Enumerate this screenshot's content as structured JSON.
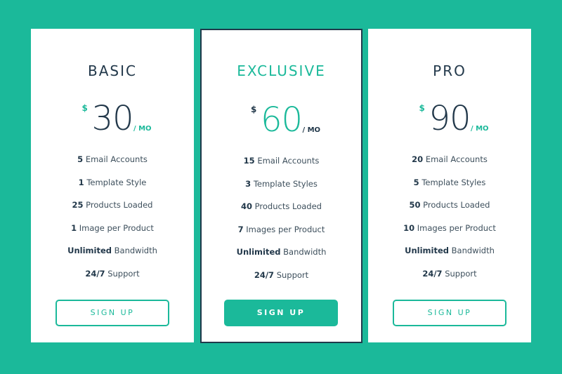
{
  "colors": {
    "background": "#1bb99a",
    "accent": "#1bb99a",
    "dark": "#22384a",
    "card": "#ffffff"
  },
  "plans": [
    {
      "name": "BASIC",
      "currency": "$",
      "price": "30",
      "period": "/ MO",
      "features": [
        {
          "bold": "5",
          "text": " Email Accounts"
        },
        {
          "bold": "1",
          "text": " Template Style"
        },
        {
          "bold": "25",
          "text": " Products Loaded"
        },
        {
          "bold": "1",
          "text": " Image per Product"
        },
        {
          "bold": "Unlimited",
          "text": " Bandwidth"
        },
        {
          "bold": "24/7",
          "text": " Support"
        }
      ],
      "button": "SIGN UP"
    },
    {
      "name": "EXCLUSIVE",
      "currency": "$",
      "price": "60",
      "period": "/ MO",
      "features": [
        {
          "bold": "15",
          "text": " Email Accounts"
        },
        {
          "bold": "3",
          "text": " Template Styles"
        },
        {
          "bold": "40",
          "text": " Products Loaded"
        },
        {
          "bold": "7",
          "text": " Images per Product"
        },
        {
          "bold": "Unlimited",
          "text": " Bandwidth"
        },
        {
          "bold": "24/7",
          "text": " Support"
        }
      ],
      "button": "SIGN UP"
    },
    {
      "name": "PRO",
      "currency": "$",
      "price": "90",
      "period": "/ MO",
      "features": [
        {
          "bold": "20",
          "text": " Email Accounts"
        },
        {
          "bold": "5",
          "text": " Template Styles"
        },
        {
          "bold": "50",
          "text": " Products Loaded"
        },
        {
          "bold": "10",
          "text": " Images per Product"
        },
        {
          "bold": "Unlimited",
          "text": " Bandwidth"
        },
        {
          "bold": "24/7",
          "text": " Support"
        }
      ],
      "button": "SIGN UP"
    }
  ]
}
